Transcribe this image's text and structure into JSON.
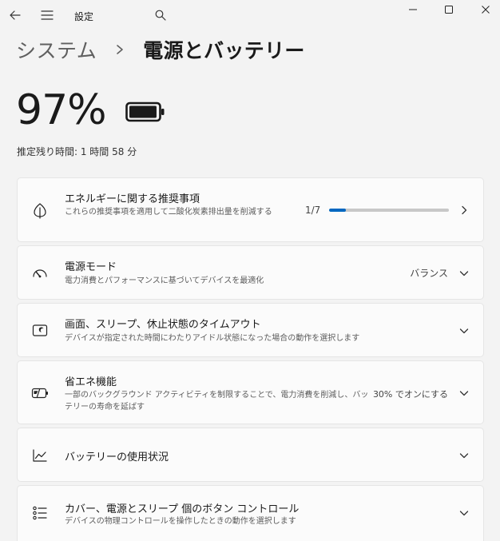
{
  "titlebar": {
    "title": "設定"
  },
  "breadcrumb": {
    "parent": "システム",
    "current": "電源とバッテリー"
  },
  "battery": {
    "percent_text": "97%",
    "percent": 97,
    "estimate": "推定残り時間: 1 時間 58 分"
  },
  "cards": {
    "recommendations": {
      "title": "エネルギーに関する推奨事項",
      "desc": "これらの推奨事項を適用して二酸化炭素排出量を削減する",
      "progress_text": "1/7",
      "progress_fraction": 0.142857
    },
    "power_mode": {
      "title": "電源モード",
      "desc": "電力消費とパフォーマンスに基づいてデバイスを最適化",
      "value": "バランス"
    },
    "screen_sleep": {
      "title": "画面、スリープ、休止状態のタイムアウト",
      "desc": "デバイスが指定された時間にわたりアイドル状態になった場合の動作を選択します"
    },
    "energy_saver": {
      "title": "省エネ機能",
      "desc": "一部のバックグラウンド アクティビティを制限することで、電力消費を削減し、バッテリーの寿命を延ばす",
      "value": "30% でオンにする"
    },
    "battery_usage": {
      "title": "バッテリーの使用状況"
    },
    "lid_buttons": {
      "title": "カバー、電源とスリープ 個のボタン コントロール",
      "desc": "デバイスの物理コントロールを操作したときの動作を選択します"
    }
  },
  "icons": {
    "back": "back-arrow-icon",
    "menu": "hamburger-menu-icon",
    "search": "search-icon",
    "minimize": "minimize-icon",
    "maximize": "maximize-icon",
    "close": "close-icon",
    "battery": "battery-icon",
    "leaf": "leaf-icon",
    "gauge": "gauge-icon",
    "screen": "screen-sleep-icon",
    "saver": "energy-saver-icon",
    "chart": "usage-chart-icon",
    "list": "button-controls-icon"
  },
  "colors": {
    "accent": "#0067c0",
    "background": "#f3f3f3",
    "card": "#fbfbfb"
  }
}
